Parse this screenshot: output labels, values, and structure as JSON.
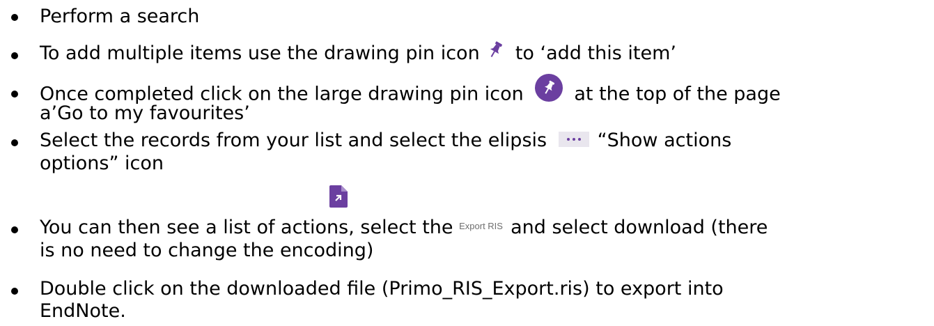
{
  "steps": [
    {
      "text": "Perform a search"
    },
    {
      "before": "To add multiple items use the drawing pin icon ",
      "icon": "pin-icon",
      "after": " to ‘add this item’"
    },
    {
      "before": "Once completed click on the large drawing pin icon ",
      "icon": "pin-circle-icon",
      "after": "at the top of the page",
      "line2": "a’Go to my favourites’"
    },
    {
      "before": "Select the records from your list and select the elipsis ",
      "icon": "ellipsis-icon",
      "after": "“Show actions",
      "line2": "options” icon"
    },
    {
      "before": "You can then see a list of actions, select the ",
      "icon": "export-ris-icon",
      "icon_label": "Export RIS",
      "after": "and select download (there",
      "line2": "is no need to change the encoding)"
    },
    {
      "text": "Double click on the downloaded file (Primo_RIS_Export.ris) to export into",
      "line2": "EndNote."
    }
  ],
  "colors": {
    "text": "#000000",
    "accent": "#6b3fa0",
    "icon_bg": "#e9e6ee",
    "label_gray": "#6e6e6e"
  }
}
